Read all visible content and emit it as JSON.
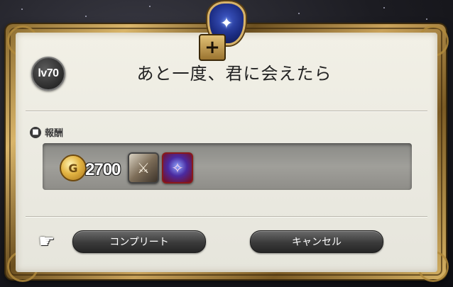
{
  "quest": {
    "level": "lv70",
    "title": "あと一度、君に会えたら"
  },
  "rewards": {
    "label": "報酬",
    "gil_amount": "2700",
    "items": [
      {
        "name": "armor-piece-icon"
      },
      {
        "name": "minion-icon"
      }
    ]
  },
  "buttons": {
    "complete": "コンプリート",
    "cancel": "キャンセル"
  },
  "colors": {
    "frame_gold": "#c9a25a",
    "panel_bg": "#ecebe2",
    "emblem_blue": "#1d2e86",
    "button_dark": "#3a3a3a"
  },
  "icons": {
    "emblem": "quest-emblem-icon",
    "plus": "plus-icon",
    "reward_header": "reward-chest-icon",
    "gil": "gil-coin-icon",
    "cursor": "pointing-hand-icon"
  }
}
